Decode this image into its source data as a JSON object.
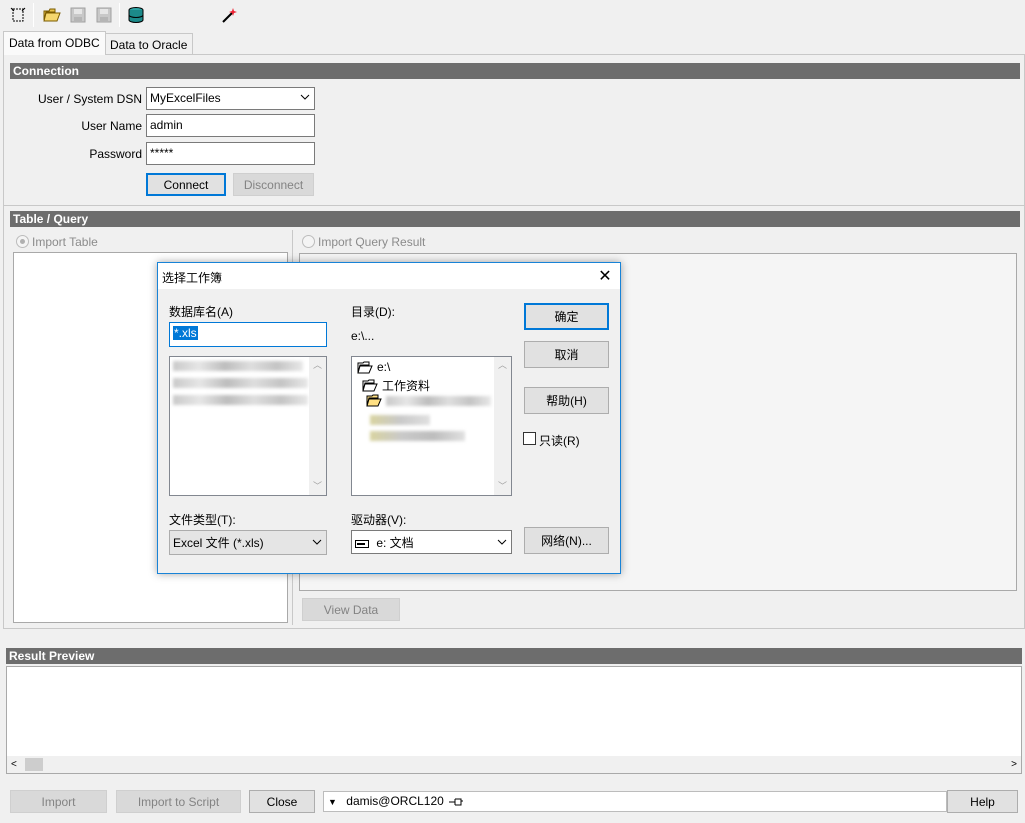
{
  "toolbar": {
    "icons": [
      "new-icon",
      "open-folder-icon",
      "save-icon",
      "save-as-icon",
      "database-icon",
      "wand-icon"
    ]
  },
  "tabs": [
    {
      "label": "Data from ODBC",
      "active": true
    },
    {
      "label": "Data to Oracle",
      "active": false
    }
  ],
  "connection": {
    "header": "Connection",
    "dsn_label": "User / System DSN",
    "dsn_value": "MyExcelFiles",
    "user_label": "User Name",
    "user_value": "admin",
    "password_label": "Password",
    "password_value": "*****",
    "connect_label": "Connect",
    "disconnect_label": "Disconnect"
  },
  "table_query": {
    "header": "Table / Query",
    "import_table_label": "Import Table",
    "import_query_label": "Import Query Result",
    "view_data_label": "View Data"
  },
  "dialog": {
    "title": "选择工作簿",
    "db_name_label": "数据库名(A)",
    "db_name_value": "*.xls",
    "dir_label": "目录(D):",
    "dir_value": "e:\\...",
    "folders": [
      "e:\\",
      "工作资料"
    ],
    "file_type_label": "文件类型(T):",
    "file_type_value": "Excel 文件 (*.xls)",
    "drive_label": "驱动器(V):",
    "drive_value": "e: 文档",
    "ok_label": "确定",
    "cancel_label": "取消",
    "help_label": "帮助(H)",
    "readonly_label": "只读(R)",
    "network_label": "网络(N)..."
  },
  "result_preview": {
    "header": "Result Preview"
  },
  "bottom": {
    "import_label": "Import",
    "import_script_label": "Import to Script",
    "close_label": "Close",
    "connection_label": "damis@ORCL120",
    "help_label": "Help"
  },
  "colors": {
    "section_header": "#6d6d6d",
    "focus_border": "#0078d7",
    "selection": "#0078d7"
  }
}
